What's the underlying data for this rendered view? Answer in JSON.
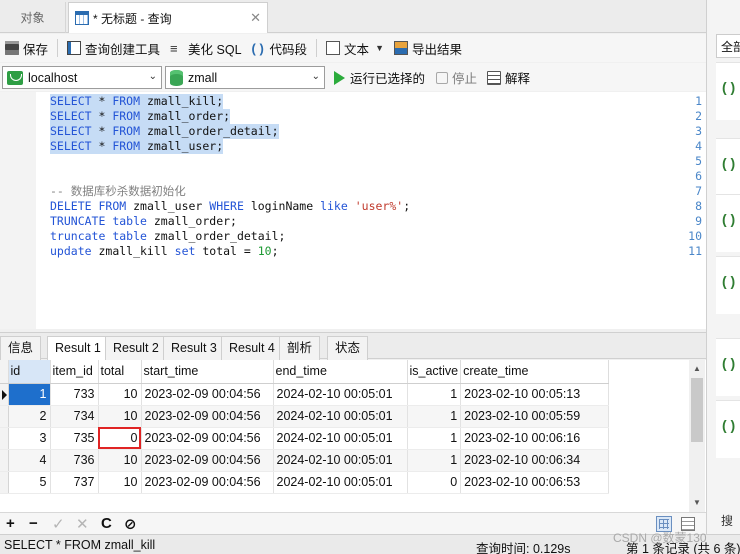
{
  "tabs": {
    "objects": "对象",
    "query": "* 无标题 - 查询"
  },
  "toolbar": {
    "save": "保存",
    "query_builder": "查询创建工具",
    "beautify": "美化 SQL",
    "code_snippet": "代码段",
    "text": "文本",
    "export": "导出结果"
  },
  "connection": {
    "server": "localhost",
    "database": "zmall",
    "run_selected": "运行已选择的",
    "stop": "停止",
    "explain": "解释"
  },
  "editor": {
    "lines": [
      {
        "n": "1",
        "text": "SELECT * FROM zmall_kill;"
      },
      {
        "n": "2",
        "text": "SELECT * FROM zmall_order;"
      },
      {
        "n": "3",
        "text": "SELECT * FROM zmall_order_detail;"
      },
      {
        "n": "4",
        "text": "SELECT * FROM zmall_user;"
      },
      {
        "n": "5",
        "text": ""
      },
      {
        "n": "6",
        "text": ""
      },
      {
        "n": "7",
        "text": "-- 数据库秒杀数据初始化"
      },
      {
        "n": "8",
        "text": "DELETE FROM zmall_user WHERE loginName like 'user%';"
      },
      {
        "n": "9",
        "text": "TRUNCATE table zmall_order;"
      },
      {
        "n": "10",
        "text": "truncate table zmall_order_detail;"
      },
      {
        "n": "11",
        "text": "update zmall_kill set total = 10;"
      }
    ]
  },
  "result_tabs": [
    "信息",
    "Result 1",
    "Result 2",
    "Result 3",
    "Result 4",
    "剖析",
    "状态"
  ],
  "grid": {
    "columns": [
      "id",
      "item_id",
      "total",
      "start_time",
      "end_time",
      "is_active",
      "create_time"
    ],
    "rows": [
      [
        "1",
        "733",
        "10",
        "2023-02-09 00:04:56",
        "2024-02-10 00:05:01",
        "1",
        "2023-02-10 00:05:13"
      ],
      [
        "2",
        "734",
        "10",
        "2023-02-09 00:04:56",
        "2024-02-10 00:05:01",
        "1",
        "2023-02-10 00:05:59"
      ],
      [
        "3",
        "735",
        "0",
        "2023-02-09 00:04:56",
        "2024-02-10 00:05:01",
        "1",
        "2023-02-10 00:06:16"
      ],
      [
        "4",
        "736",
        "10",
        "2023-02-09 00:04:56",
        "2024-02-10 00:05:01",
        "1",
        "2023-02-10 00:06:34"
      ],
      [
        "5",
        "737",
        "10",
        "2023-02-09 00:04:56",
        "2024-02-10 00:05:01",
        "0",
        "2023-02-10 00:06:53"
      ]
    ]
  },
  "grid_tools": {
    "add": "+",
    "delete": "−",
    "apply": "✓",
    "discard": "✕",
    "refresh": "C",
    "stop": "⊘"
  },
  "right_panel": {
    "filter": "全部",
    "search": "搜"
  },
  "status": {
    "sql": "SELECT * FROM zmall_kill",
    "time": "查询时间: 0.129s",
    "records": "第 1 条记录 (共 6 条)"
  },
  "watermark": "CSDN @数蒙130",
  "colors": {
    "keyword": "#2354d6",
    "comment": "#808080",
    "string": "#c0392b",
    "number": "#1d9a33",
    "selection": "#c6dcf5",
    "highlight_box": "#e02424"
  }
}
